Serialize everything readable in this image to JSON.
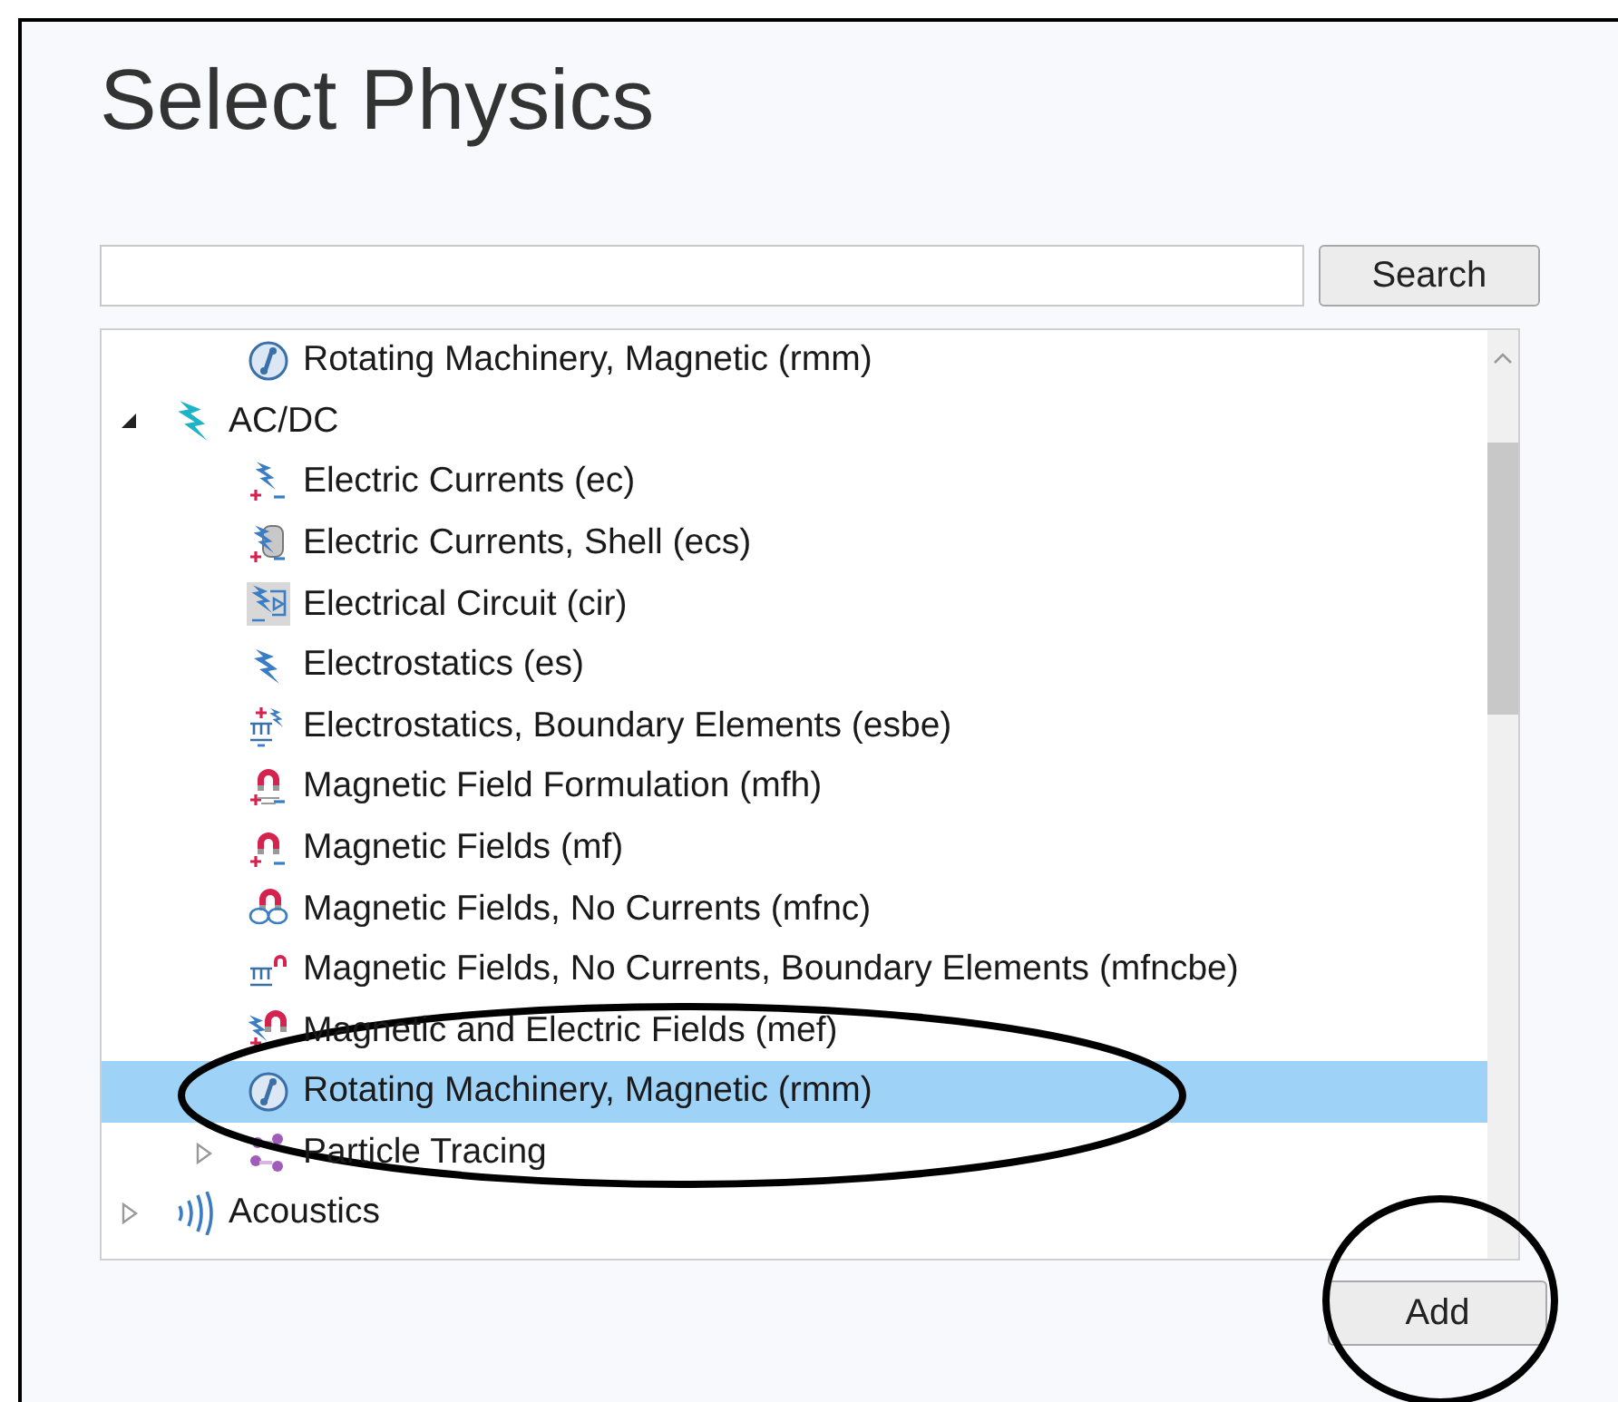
{
  "title": "Select Physics",
  "search": {
    "button": "Search"
  },
  "tree": {
    "items": [
      {
        "children": [
          {
            "label": "Rotating Machinery, Magnetic (rmm)",
            "kind": "rotating",
            "selected": false
          }
        ]
      },
      {
        "label": "AC/DC",
        "kind": "acdc",
        "expanded": true,
        "selected": false,
        "children": [
          {
            "label": "Electric Currents (ec)",
            "kind": "current",
            "selected": false
          },
          {
            "label": "Electric Currents, Shell (ecs)",
            "kind": "shell",
            "selected": false
          },
          {
            "label": "Electrical Circuit (cir)",
            "kind": "circuit",
            "selected": false
          },
          {
            "label": "Electrostatics (es)",
            "kind": "electrostatics",
            "selected": false
          },
          {
            "label": "Electrostatics, Boundary Elements (esbe)",
            "kind": "esboundary",
            "selected": false
          },
          {
            "label": "Magnetic Field Formulation (mfh)",
            "kind": "formulation",
            "selected": false
          },
          {
            "label": "Magnetic Fields (mf)",
            "kind": "magnet",
            "selected": false
          },
          {
            "label": "Magnetic Fields, No Currents (mfnc)",
            "kind": "loops",
            "selected": false
          },
          {
            "label": "Magnetic Fields, No Currents, Boundary Elements (mfncbe)",
            "kind": "mboundary",
            "selected": false
          },
          {
            "label": "Magnetic and Electric Fields (mef)",
            "kind": "electromagnet",
            "selected": false
          },
          {
            "label": "Rotating Machinery, Magnetic (rmm)",
            "kind": "rotating",
            "selected": true
          },
          {
            "label": "Particle Tracing",
            "kind": "particles",
            "expanded": false,
            "selected": false
          }
        ]
      },
      {
        "label": "Acoustics",
        "kind": "acoustics",
        "expanded": false,
        "selected": false
      }
    ]
  },
  "add_button": "Add"
}
